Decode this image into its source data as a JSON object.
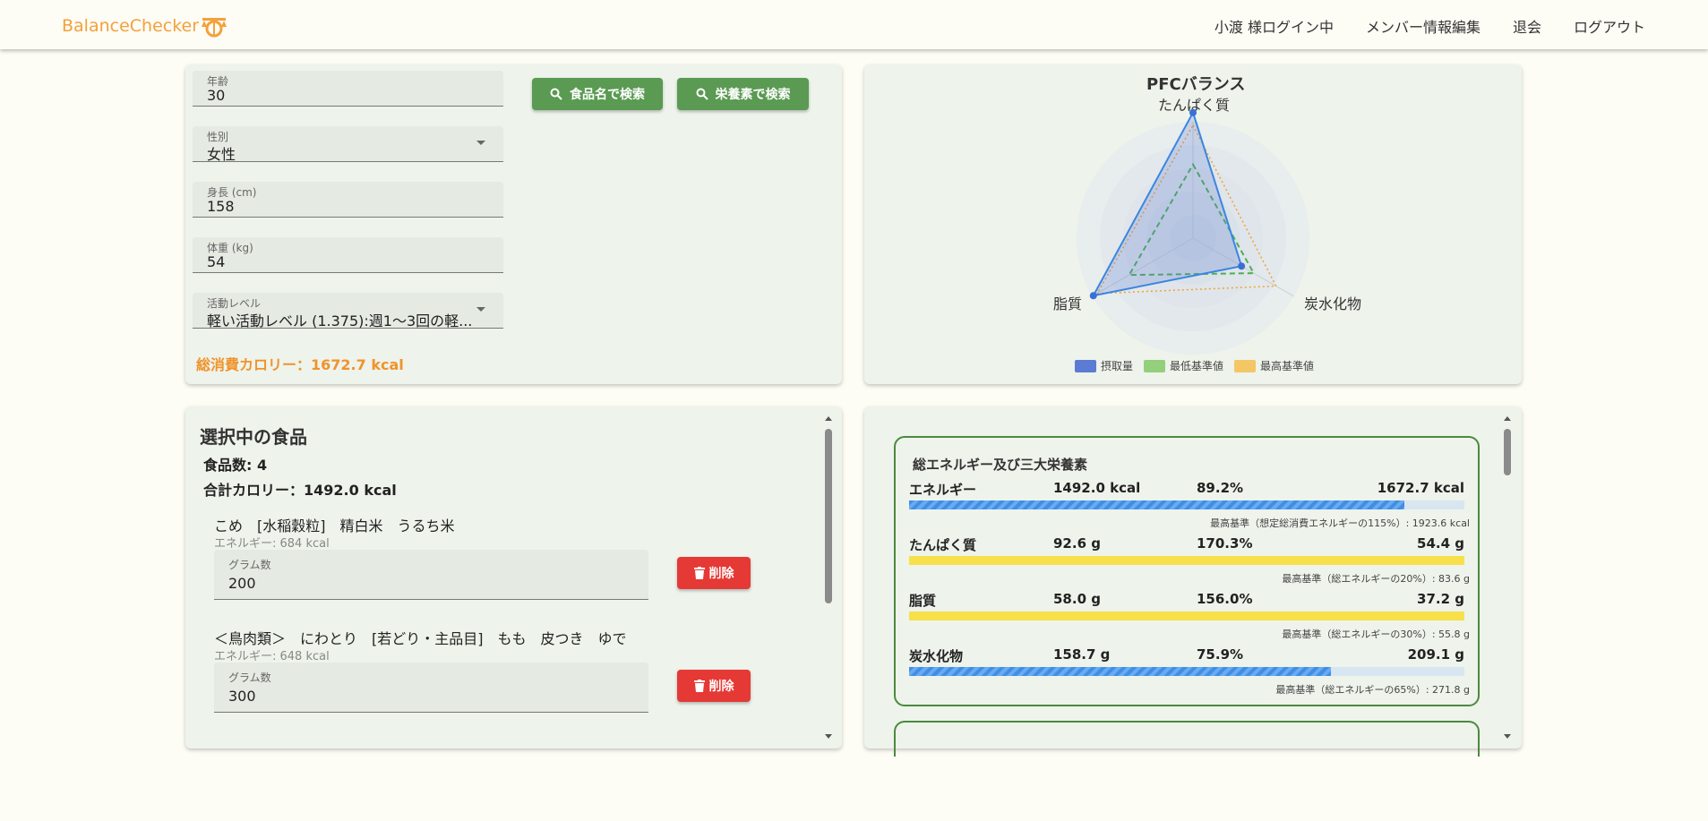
{
  "header": {
    "brand": "BalanceChecker",
    "nav": [
      "小渡 様ログイン中",
      "メンバー情報編集",
      "退会",
      "ログアウト"
    ]
  },
  "profile": {
    "age": {
      "label": "年齢",
      "value": "30"
    },
    "sex": {
      "label": "性別",
      "value": "女性"
    },
    "height": {
      "label": "身長 (cm)",
      "value": "158"
    },
    "weight": {
      "label": "体重 (kg)",
      "value": "54"
    },
    "activity": {
      "label": "活動レベル",
      "value": "軽い活動レベル (1.375):週1〜3回の軽..."
    },
    "total_cal": "総消費カロリー：1672.7 kcal"
  },
  "search": {
    "by_name": "食品名で検索",
    "by_nutrient": "栄養素で検索"
  },
  "chart": {
    "title": "PFCバランス",
    "axes": [
      "たんぱく質",
      "炭水化物",
      "脂質"
    ],
    "legend": [
      {
        "name": "摂取量",
        "color": "#5b7bd5"
      },
      {
        "name": "最低基準値",
        "color": "#93cf7c"
      },
      {
        "name": "最高基準値",
        "color": "#f3c765"
      }
    ]
  },
  "chart_data": {
    "type": "radar",
    "title": "PFCバランス",
    "categories": [
      "たんぱく質",
      "炭水化物",
      "脂質"
    ],
    "series": [
      {
        "name": "摂取量",
        "values": [
          170.3,
          75.9,
          156.0
        ]
      },
      {
        "name": "最低基準値",
        "values": [
          100,
          95,
          100
        ]
      },
      {
        "name": "最高基準値",
        "values": [
          153,
          130,
          150
        ]
      }
    ]
  },
  "selected": {
    "title": "選択中の食品",
    "count": "食品数: 4",
    "total": "合計カロリー：1492.0 kcal",
    "foods": [
      {
        "name": "こめ　[水稲穀粒]　精白米　うるち米",
        "energy": "エネルギー: 684 kcal",
        "gram_label": "グラム数",
        "grams": "200",
        "delete": "削除"
      },
      {
        "name": "＜鳥肉類＞　にわとり　[若どり・主品目]　もも　皮つき　ゆで",
        "energy": "エネルギー: 648 kcal",
        "gram_label": "グラム数",
        "grams": "300",
        "delete": "削除"
      }
    ]
  },
  "nutrients": {
    "title": "総エネルギー及び三大栄養素",
    "rows": [
      {
        "name": "エネルギー",
        "value": "1492.0 kcal",
        "pct": "89.2%",
        "ref": "1672.7 kcal",
        "ratio": 0.892,
        "style": "blue",
        "note": "最高基準（想定総消費エネルギーの115%）: 1923.6 kcal"
      },
      {
        "name": "たんぱく質",
        "value": "92.6 g",
        "pct": "170.3%",
        "ref": "54.4 g",
        "ratio": 1.0,
        "style": "yellow",
        "note": "最高基準（総エネルギーの20%）: 83.6 g"
      },
      {
        "name": "脂質",
        "value": "58.0 g",
        "pct": "156.0%",
        "ref": "37.2 g",
        "ratio": 1.0,
        "style": "yellow",
        "note": "最高基準（総エネルギーの30%）: 55.8 g"
      },
      {
        "name": "炭水化物",
        "value": "158.7 g",
        "pct": "75.9%",
        "ref": "209.1 g",
        "ratio": 0.759,
        "style": "blue",
        "note": "最高基準（総エネルギーの65%）: 271.8 g"
      }
    ]
  }
}
